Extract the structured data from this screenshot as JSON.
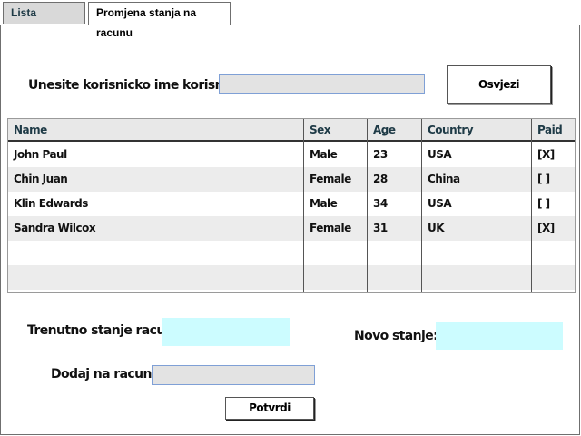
{
  "tabs": [
    {
      "label": "Lista zahtjeva"
    },
    {
      "label": "Promjena stanja na racunu"
    }
  ],
  "search": {
    "label": "Unesite korisnicko ime korisnika:",
    "value": "",
    "refresh_label": "Osvjezi"
  },
  "table": {
    "columns": [
      "Name",
      "Sex",
      "Age",
      "Country",
      "Paid"
    ],
    "rows": [
      {
        "name": "John Paul",
        "sex": "Male",
        "age": "23",
        "country": "USA",
        "paid": "[X]"
      },
      {
        "name": "Chin Juan",
        "sex": "Female",
        "age": "28",
        "country": "China",
        "paid": "[ ]"
      },
      {
        "name": "Klin Edwards",
        "sex": "Male",
        "age": "34",
        "country": "USA",
        "paid": "[ ]"
      },
      {
        "name": "Sandra Wilcox",
        "sex": "Female",
        "age": "31",
        "country": "UK",
        "paid": "[X]"
      }
    ]
  },
  "balance": {
    "current_label": "Trenutno stanje racuna:",
    "current_value": "",
    "new_label": "Novo stanje:",
    "new_value": "",
    "add_label": "Dodaj na racun:",
    "add_value": "",
    "confirm_label": "Potvrdi"
  },
  "colors": {
    "tab_active_bg": "#d9d9d9",
    "field_gray": "#e3e3e3",
    "field_cyan": "#ccfcff",
    "header_text": "#1e3a46"
  }
}
